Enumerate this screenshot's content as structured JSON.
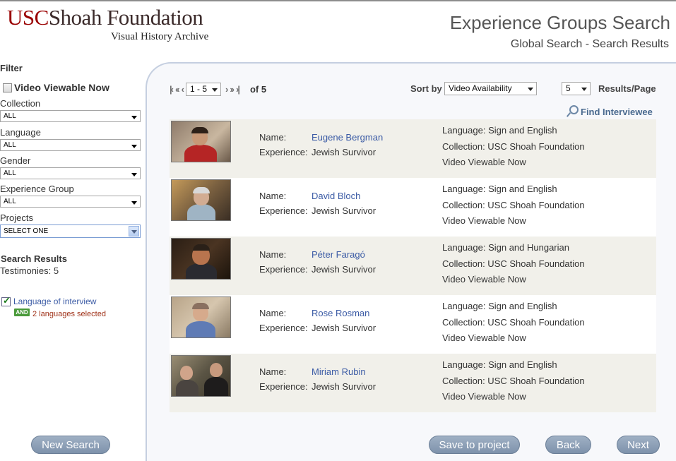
{
  "header": {
    "logo_usc": "USC",
    "logo_sf": "Shoah Foundation",
    "logo_sub": "Visual History Archive",
    "title": "Experience Groups Search",
    "subtitle": "Global Search - Search Results"
  },
  "sidebar": {
    "filter_title": "Filter",
    "video_viewable_label": "Video Viewable Now",
    "video_viewable_checked": false,
    "filters": [
      {
        "label": "Collection",
        "value": "ALL"
      },
      {
        "label": "Language",
        "value": "ALL"
      },
      {
        "label": "Gender",
        "value": "ALL"
      },
      {
        "label": "Experience Group",
        "value": "ALL"
      },
      {
        "label": "Projects",
        "value": "SELECT ONE"
      }
    ],
    "search_results_title": "Search Results",
    "testimonies_text": "Testimonies: 5",
    "language_filter_label": "Language of interview",
    "language_filter_checked": true,
    "and_badge": "AND",
    "languages_selected": "2 languages selected",
    "new_search_label": "New Search"
  },
  "pager": {
    "range_value": "1 - 5",
    "of_text": "of 5",
    "sort_label": "Sort by",
    "sort_value": "Video Availability",
    "per_page_value": "5",
    "per_page_label": "Results/Page",
    "find_label": "Find Interviewee"
  },
  "labels": {
    "name": "Name:",
    "experience": "Experience:"
  },
  "results": [
    {
      "name": "Eugene Bergman",
      "experience": "Jewish Survivor",
      "language": "Language: Sign and English",
      "collection": "Collection: USC Shoah Foundation",
      "video": "Video Viewable Now"
    },
    {
      "name": "David Bloch",
      "experience": "Jewish Survivor",
      "language": "Language: Sign and English",
      "collection": "Collection: USC Shoah Foundation",
      "video": "Video Viewable Now"
    },
    {
      "name": "Péter Faragó",
      "experience": "Jewish Survivor",
      "language": "Language: Sign and Hungarian",
      "collection": "Collection: USC Shoah Foundation",
      "video": "Video Viewable Now"
    },
    {
      "name": "Rose Rosman",
      "experience": "Jewish Survivor",
      "language": "Language: Sign and English",
      "collection": "Collection: USC Shoah Foundation",
      "video": "Video Viewable Now"
    },
    {
      "name": "Miriam Rubin",
      "experience": "Jewish Survivor",
      "language": "Language: Sign and English",
      "collection": "Collection: USC Shoah Foundation",
      "video": "Video Viewable Now"
    }
  ],
  "footer": {
    "save_label": "Save to project",
    "back_label": "Back",
    "next_label": "Next"
  },
  "colors": {
    "brand_red": "#9a0000",
    "link_blue": "#3b5ba5",
    "pill_button": "#8a9db4",
    "row_alt": "#f1f0ea",
    "and_badge": "#4a9a3a"
  }
}
